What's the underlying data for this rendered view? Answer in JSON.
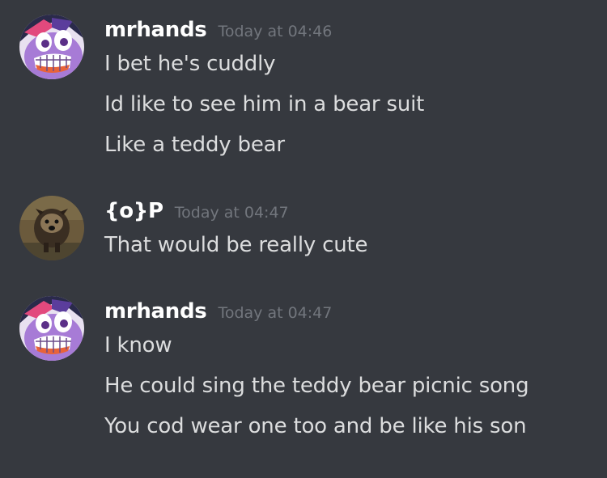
{
  "colors": {
    "background": "#36393f",
    "username": "#ffffff",
    "timestamp": "#72767d",
    "message_text": "#dcddde"
  },
  "messages": [
    {
      "author": "mrhands",
      "timestamp": "Today at 04:46",
      "avatar_icon": "purple-pony-avatar",
      "lines": [
        "I bet he's cuddly",
        "Id like to see him in a bear suit",
        "Like a teddy bear"
      ]
    },
    {
      "author": "{o}P",
      "timestamp": "Today at 04:47",
      "avatar_icon": "dog-photo-avatar",
      "lines": [
        "That would be really cute"
      ]
    },
    {
      "author": "mrhands",
      "timestamp": "Today at 04:47",
      "avatar_icon": "purple-pony-avatar",
      "lines": [
        "I know",
        "He could sing the teddy bear picnic song",
        "You cod wear one too and be like his son"
      ]
    }
  ]
}
